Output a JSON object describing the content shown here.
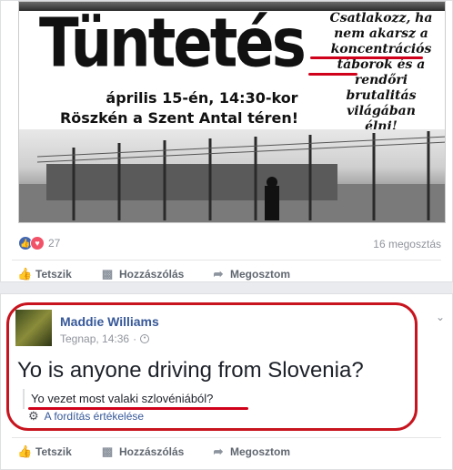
{
  "post1": {
    "poster": {
      "title": "Tüntetés",
      "date_line": "április 15-én, 14:30-kor",
      "place_line": "Röszkén a Szent Antal téren!",
      "side_lines": [
        "Csatlakozz, ha",
        "nem akarsz a",
        "koncentrációs",
        "táborok és a",
        "rendőri",
        "brutalitás",
        "világában",
        "élni!"
      ]
    },
    "reaction_count": "27",
    "shares": "16 megosztás",
    "actions": {
      "like": "Tetszik",
      "comment": "Hozzászólás",
      "share": "Megosztom"
    }
  },
  "post2": {
    "author": "Maddie Williams",
    "time": "Tegnap, 14:36",
    "separator": "·",
    "text": "Yo is anyone driving from Slovenia?",
    "translation": "Yo vezet most valaki szlovéniából?",
    "rate_translation": "A fordítás értékelése",
    "actions": {
      "like": "Tetszik",
      "comment": "Hozzászólás",
      "share": "Megosztom"
    }
  },
  "colors": {
    "accent_red": "#c8141e",
    "link_blue": "#365899",
    "like_blue": "#4267b2",
    "love_red": "#f25268"
  },
  "icons": [
    "like-icon",
    "love-icon",
    "thumbs-up-icon",
    "comment-icon",
    "share-arrow-icon",
    "globe-icon",
    "chevron-down-icon",
    "gear-icon"
  ]
}
